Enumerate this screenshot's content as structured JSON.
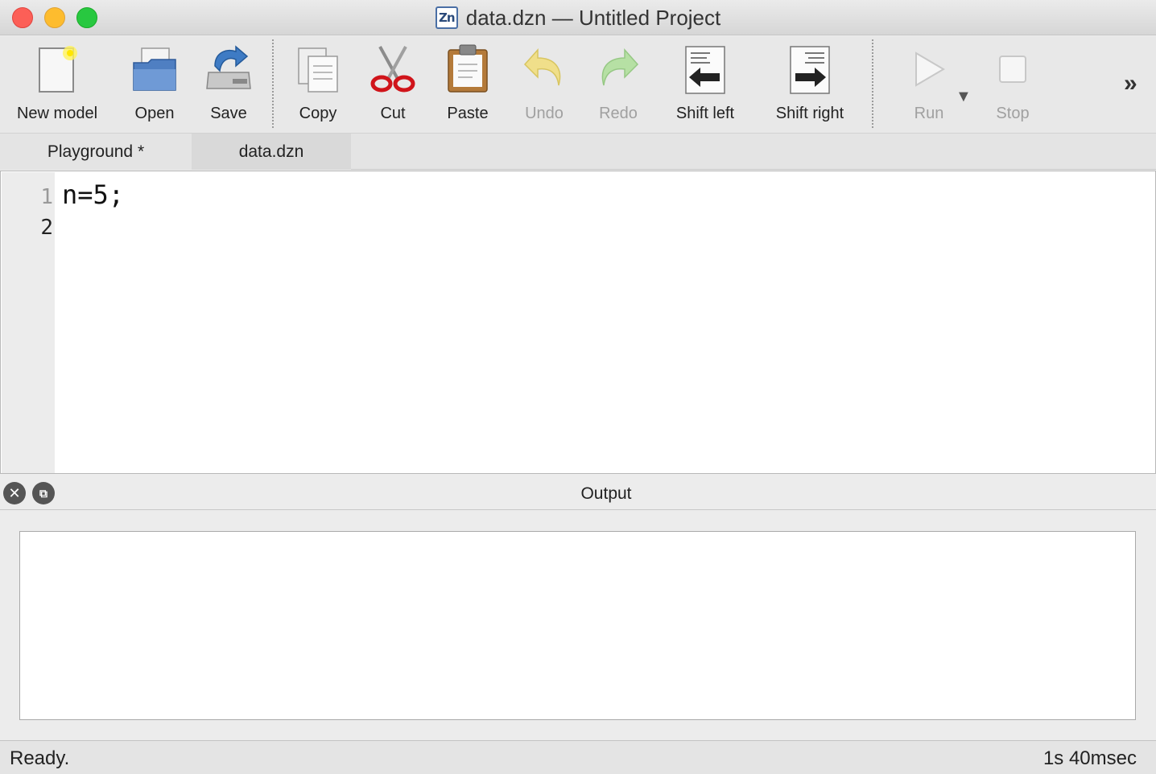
{
  "window": {
    "title": "data.dzn — Untitled Project",
    "app_icon_text": "Zn"
  },
  "toolbar": {
    "items": [
      {
        "label": "New model",
        "icon": "new-document-icon",
        "enabled": true
      },
      {
        "label": "Open",
        "icon": "open-folder-icon",
        "enabled": true
      },
      {
        "label": "Save",
        "icon": "save-disk-icon",
        "enabled": true
      },
      {
        "label": "Copy",
        "icon": "copy-icon",
        "enabled": true
      },
      {
        "label": "Cut",
        "icon": "scissors-icon",
        "enabled": true
      },
      {
        "label": "Paste",
        "icon": "clipboard-icon",
        "enabled": true
      },
      {
        "label": "Undo",
        "icon": "undo-arrow-icon",
        "enabled": false
      },
      {
        "label": "Redo",
        "icon": "redo-arrow-icon",
        "enabled": false
      },
      {
        "label": "Shift left",
        "icon": "shift-left-icon",
        "enabled": true
      },
      {
        "label": "Shift right",
        "icon": "shift-right-icon",
        "enabled": true
      },
      {
        "label": "Run",
        "icon": "play-icon",
        "enabled": false
      },
      {
        "label": "Stop",
        "icon": "stop-icon",
        "enabled": false
      }
    ],
    "overflow_glyph": "»"
  },
  "tabs": [
    {
      "label": "Playground *",
      "active": true
    },
    {
      "label": "data.dzn",
      "active": false
    }
  ],
  "editor": {
    "line_numbers": [
      "1",
      "2"
    ],
    "lines": [
      "n=5;",
      ""
    ]
  },
  "output": {
    "title": "Output"
  },
  "status": {
    "message": "Ready.",
    "elapsed": "1s 40msec"
  },
  "colors": {
    "close": "#fc5f57",
    "minimize": "#fdbc2e",
    "maximize": "#28c840"
  }
}
